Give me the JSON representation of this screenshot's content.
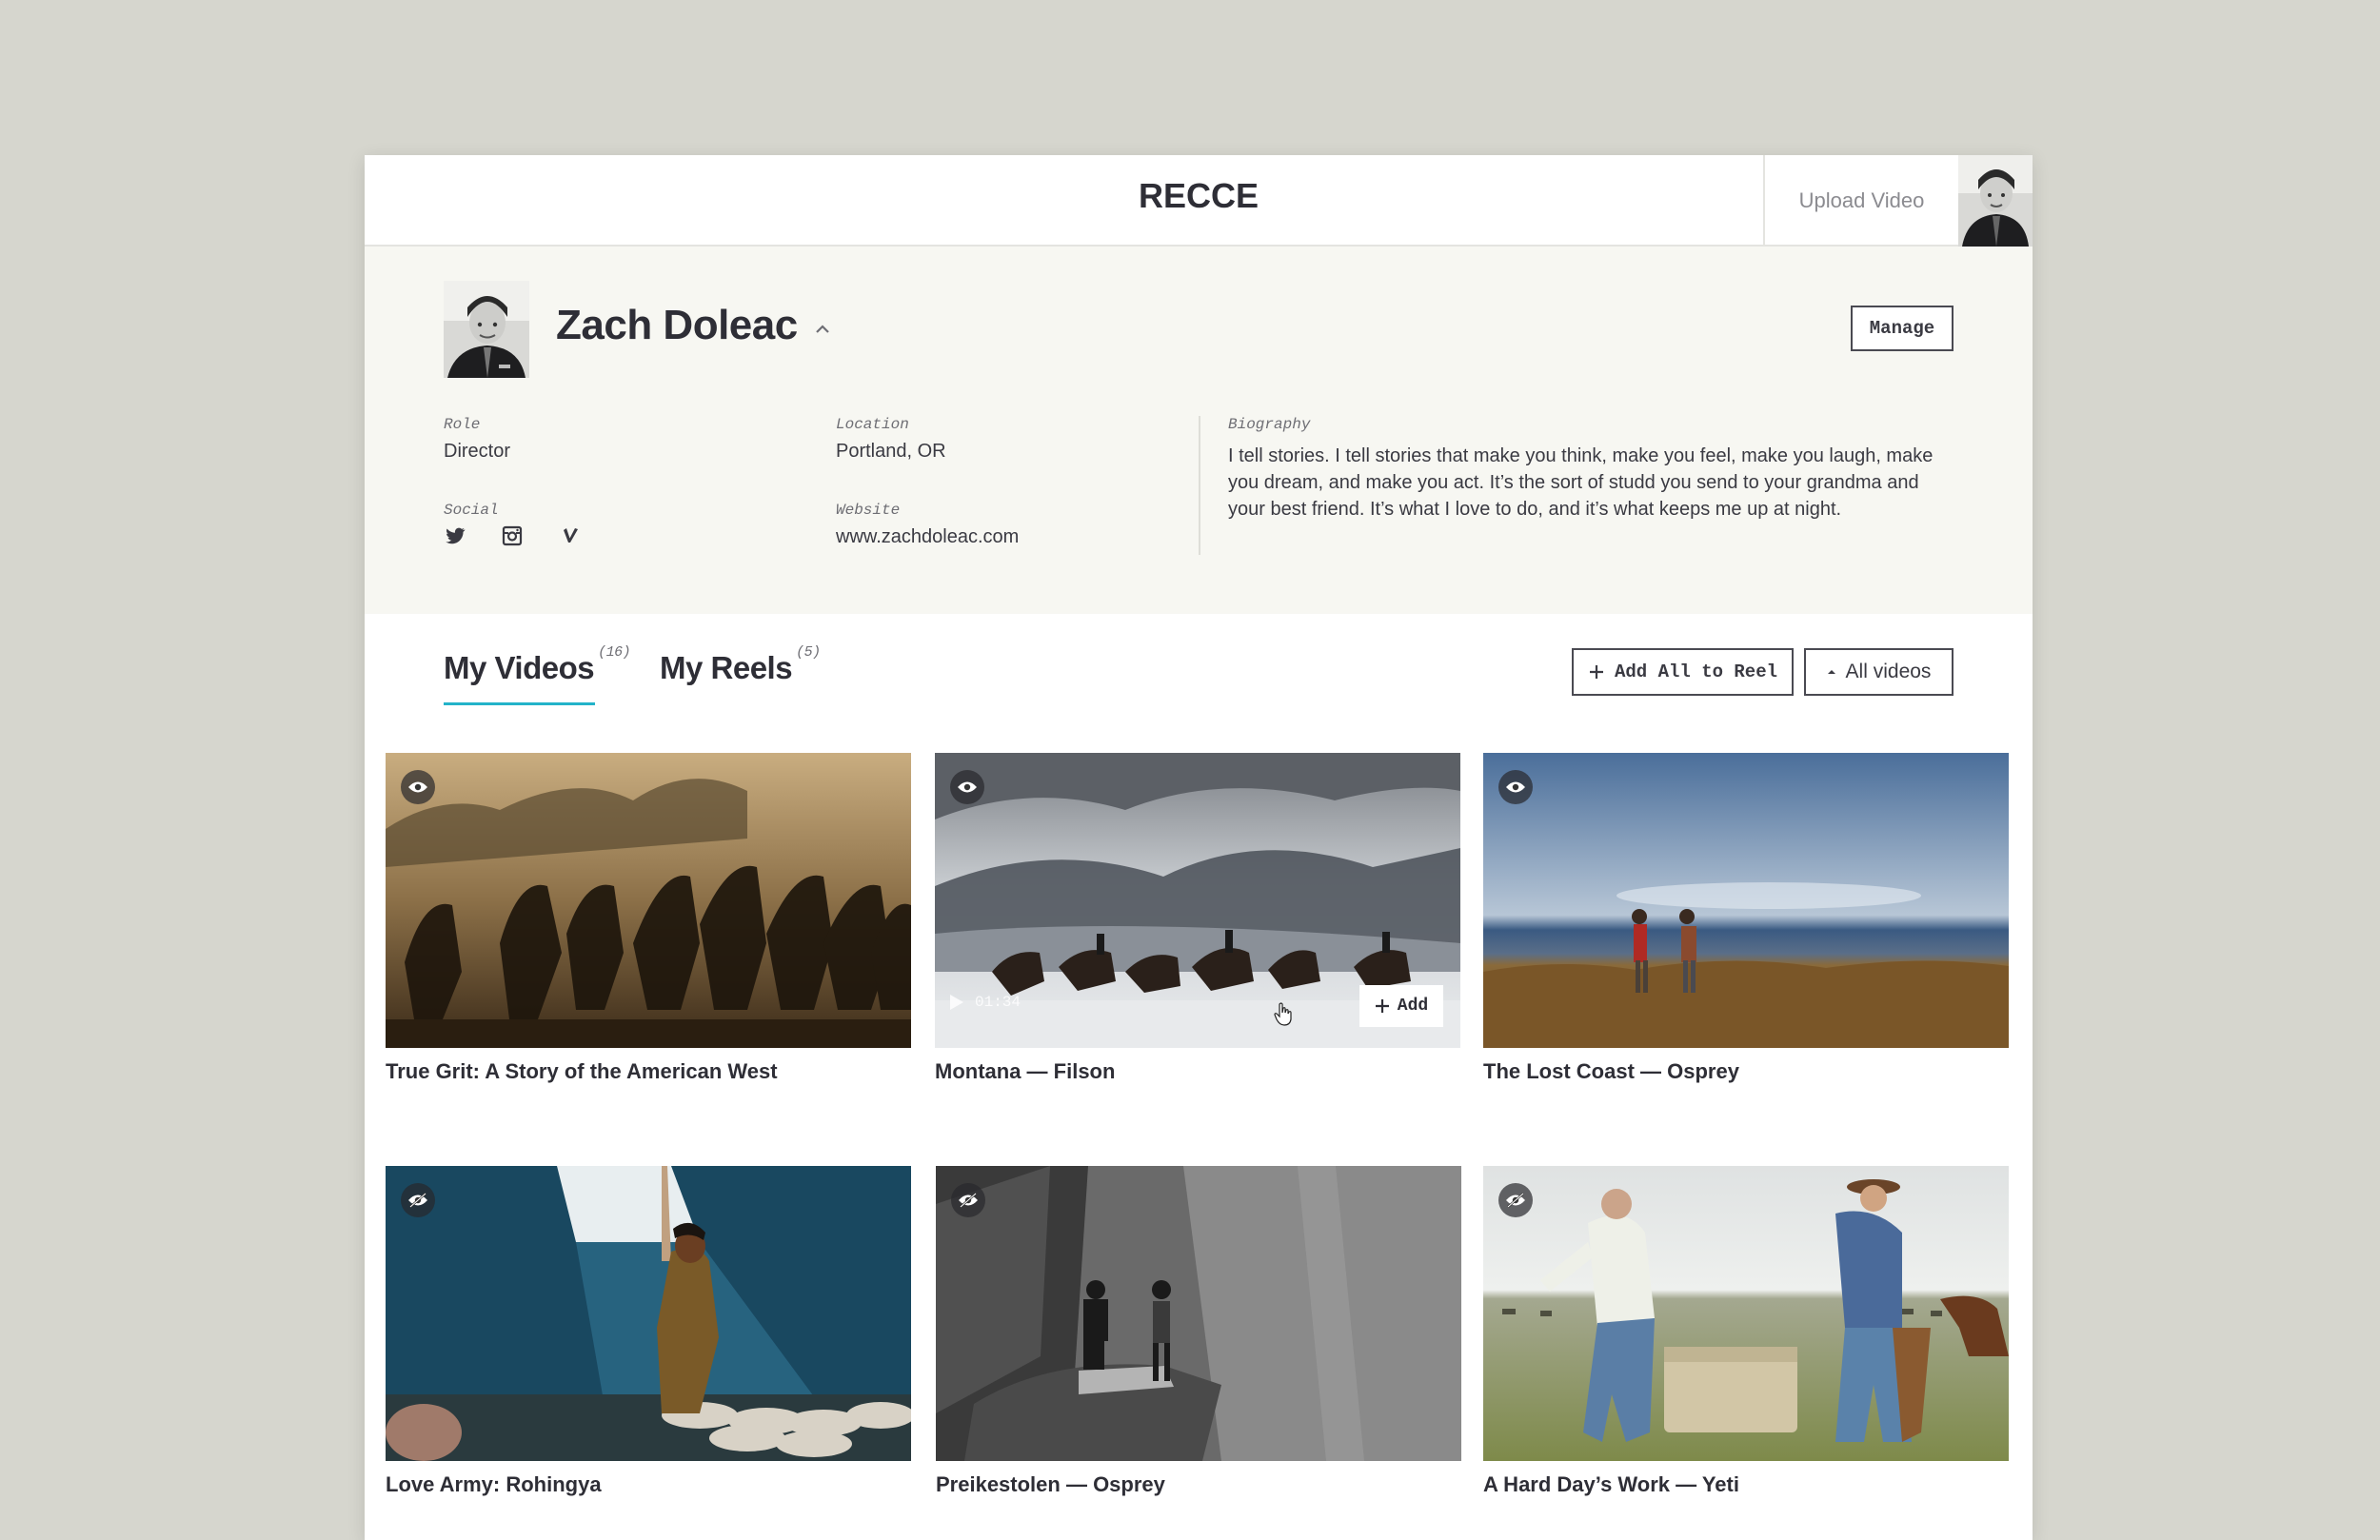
{
  "header": {
    "logo": "RECCE",
    "upload_label": "Upload Video"
  },
  "profile": {
    "name": "Zach Doleac",
    "manage_label": "Manage",
    "role_label": "Role",
    "role_value": "Director",
    "location_label": "Location",
    "location_value": "Portland, OR",
    "social_label": "Social",
    "website_label": "Website",
    "website_value": "www.zachdoleac.com",
    "biography_label": "Biography",
    "biography_value": "I tell stories. I tell stories that make you think, make you feel, make you laugh, make you dream, and make you act. It’s the sort of studd you send to your grandma and your best friend. It’s what I love to do, and it’s what keeps me up at night.",
    "social_icons": [
      "twitter-icon",
      "instagram-icon",
      "vimeo-icon"
    ]
  },
  "tabs": [
    {
      "label": "My Videos",
      "count": "(16)",
      "active": true
    },
    {
      "label": "My Reels",
      "count": "(5)",
      "active": false
    }
  ],
  "actions": {
    "add_all_label": "Add All to Reel",
    "filter_label": "All videos"
  },
  "videos": [
    {
      "title": "True Grit: A Story of the American West",
      "visible": true
    },
    {
      "title": "Montana — Filson",
      "visible": true,
      "duration": "01:34",
      "add_label": "Add"
    },
    {
      "title": "The Lost Coast — Osprey",
      "visible": true
    },
    {
      "title": "Love Army: Rohingya",
      "visible": false
    },
    {
      "title": "Preikestolen — Osprey",
      "visible": false
    },
    {
      "title": "A Hard Day’s Work — Yeti",
      "visible": false
    }
  ],
  "colors": {
    "accent": "#23b3c9",
    "text": "#2e2e36",
    "profile_bg": "#f7f7f2",
    "page_bg": "#d6d6ce"
  }
}
